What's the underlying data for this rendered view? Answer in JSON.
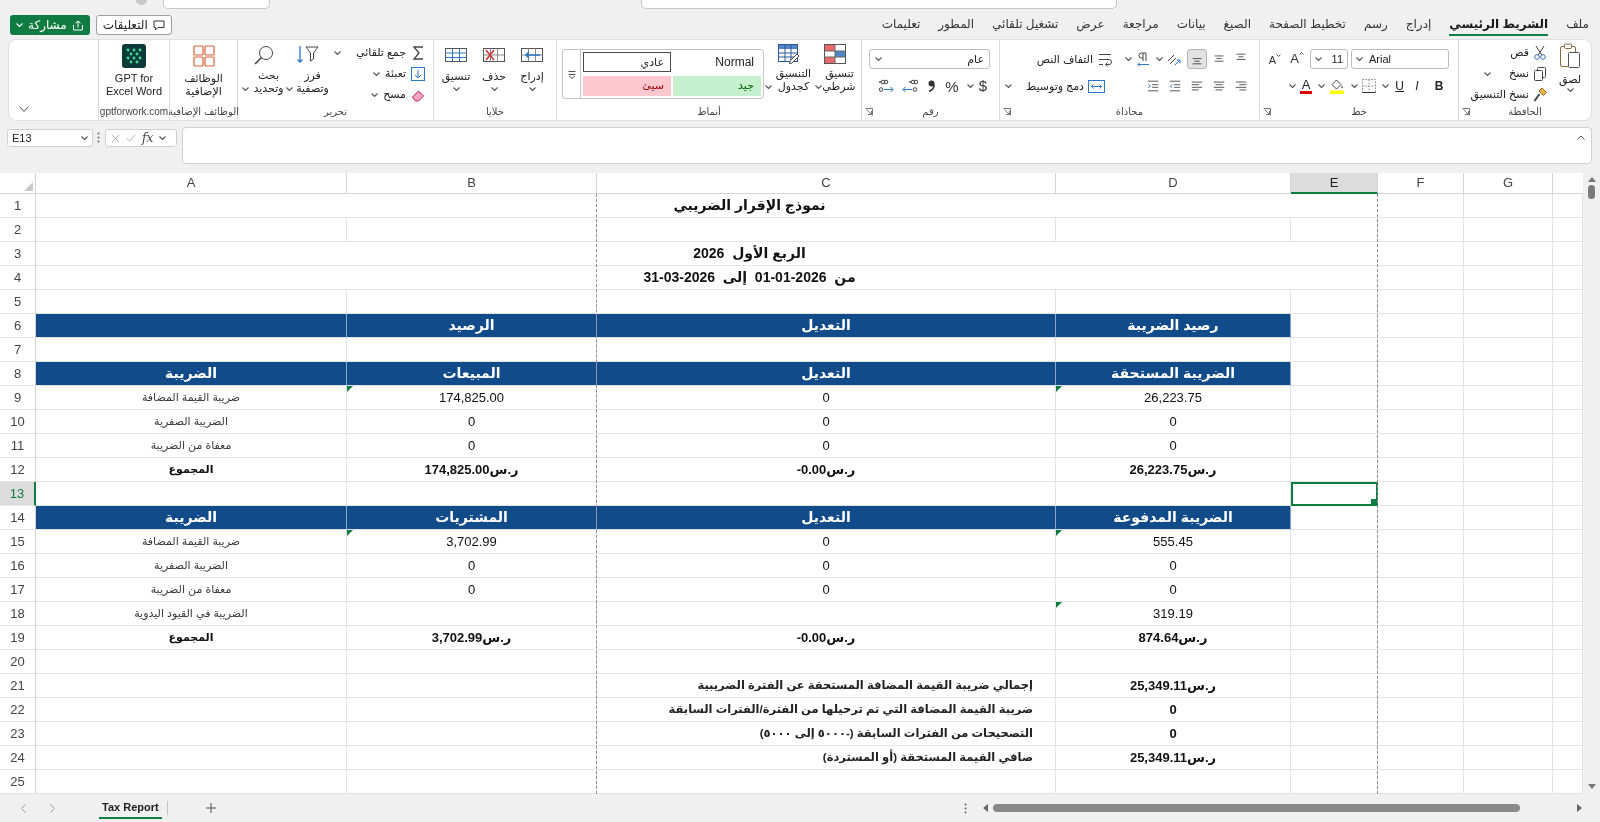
{
  "header_buttons": [
    {
      "kind": "comments",
      "label": "التعليقات"
    },
    {
      "kind": "share",
      "label": "مشاركة"
    }
  ],
  "ribbon_tabs": [
    {
      "label": "ملف",
      "selected": false
    },
    {
      "label": "الشريط الرئيسي",
      "selected": true
    },
    {
      "label": "إدراج",
      "selected": false
    },
    {
      "label": "رسم",
      "selected": false
    },
    {
      "label": "تخطيط الصفحة",
      "selected": false
    },
    {
      "label": "الصيغ",
      "selected": false
    },
    {
      "label": "بيانات",
      "selected": false
    },
    {
      "label": "مراجعة",
      "selected": false
    },
    {
      "label": "عرض",
      "selected": false
    },
    {
      "label": "تشغيل تلقائي",
      "selected": false
    },
    {
      "label": "المطور",
      "selected": false
    },
    {
      "label": "تعليمات",
      "selected": false
    }
  ],
  "ribbon_groups": [
    {
      "kind": "clipboard",
      "label": "الحافظة",
      "paste": "لصق",
      "cut": "قص",
      "copy": "نسخ",
      "format_painter": "نسخ التنسيق"
    },
    {
      "kind": "font",
      "label": "خط",
      "font_name": "Arial",
      "font_size": "11",
      "grow": "A",
      "shrink": "A",
      "bold": "B",
      "italic": "I",
      "underline": "U",
      "font_color": "A"
    },
    {
      "kind": "alignment",
      "label": "محاذاة",
      "vertical": [
        {
          "kind": "top",
          "selected": false
        },
        {
          "kind": "middle",
          "selected": false
        },
        {
          "kind": "bottom",
          "selected": true
        }
      ],
      "wrap_text": "التفاف النص",
      "merge": "دمج وتوسيط"
    },
    {
      "kind": "number",
      "label": "رقم",
      "format": "عام",
      "currency": "$",
      "percent": "%"
    },
    {
      "kind": "styles",
      "label": "أنماط",
      "conditional": "تنسيق شرطي",
      "as_table": "التنسيق كجدول",
      "gallery": [
        {
          "kind": "normal",
          "label": "Normal",
          "selected": false
        },
        {
          "kind": "plain",
          "label": "عادي",
          "selected": true
        },
        {
          "kind": "good",
          "label": "جيد",
          "selected": false
        },
        {
          "kind": "bad",
          "label": "سيئ",
          "selected": false
        }
      ]
    },
    {
      "kind": "cells",
      "label": "خلايا",
      "buttons": [
        {
          "kind": "insert",
          "label": "إدراج"
        },
        {
          "kind": "delete",
          "label": "حذف"
        },
        {
          "kind": "format",
          "label": "تنسيق"
        }
      ]
    },
    {
      "kind": "editing",
      "label": "تحرير",
      "autosum": "جمع تلقائي",
      "fill": "تعبئة",
      "clear": "مسح",
      "sort": "فرز وتصفية",
      "find": "بحث وتحديد"
    },
    {
      "kind": "addins",
      "label": "الوظائف الإضافية",
      "button": "الوظائف الإضافية"
    },
    {
      "kind": "gpt",
      "label": "gptforwork.com",
      "button": "GPT for Excel Word"
    }
  ],
  "formula_bar": {
    "name_box": "E13",
    "function_label": "fx"
  },
  "sheet": {
    "columns": [
      {
        "label": "G",
        "selected": false
      },
      {
        "label": "F",
        "selected": false
      },
      {
        "label": "E",
        "selected": true
      },
      {
        "label": "D",
        "selected": false
      },
      {
        "label": "C",
        "selected": false
      },
      {
        "label": "B",
        "selected": false
      },
      {
        "label": "A",
        "selected": false
      }
    ],
    "rows": [
      {
        "number": "1",
        "selected": false,
        "kind": "title",
        "text": "نموذج الإقرار الضريبي"
      },
      {
        "number": "2",
        "selected": false,
        "kind": "blank"
      },
      {
        "number": "3",
        "selected": false,
        "kind": "title",
        "text": "الربع الأول  2026"
      },
      {
        "number": "4",
        "selected": false,
        "kind": "title",
        "text": "من  2026-01-01  إلى  2026-03-31"
      },
      {
        "number": "5",
        "selected": false,
        "kind": "blank"
      },
      {
        "number": "6",
        "selected": false,
        "kind": "header",
        "b": "الرصيد",
        "c": "التعديل",
        "d": "رصيد الضريبة"
      },
      {
        "number": "7",
        "selected": false,
        "kind": "blank"
      },
      {
        "number": "8",
        "selected": false,
        "kind": "header",
        "a": "الضريبة",
        "b": "المبيعات",
        "c": "التعديل",
        "d": "الضريبة المستحقة"
      },
      {
        "number": "9",
        "selected": false,
        "kind": "data",
        "a": "ضريبة القيمة المضافة",
        "b": "174,825.00",
        "c": "0",
        "d": "26,223.75",
        "flag_b": true,
        "flag_d": true
      },
      {
        "number": "10",
        "selected": false,
        "kind": "data",
        "a": "الضريبة الصفرية",
        "b": "0",
        "c": "0",
        "d": "0",
        "flag_b": false,
        "flag_d": false
      },
      {
        "number": "11",
        "selected": false,
        "kind": "data",
        "a": "معفاة من الضريبة",
        "b": "0",
        "c": "0",
        "d": "0",
        "flag_b": false,
        "flag_d": false
      },
      {
        "number": "12",
        "selected": false,
        "kind": "total",
        "a": "المجموع",
        "b": "174,825.00ر.س",
        "c": "-0.00ر.س",
        "d": "26,223.75ر.س"
      },
      {
        "number": "13",
        "selected": true,
        "kind": "blank"
      },
      {
        "number": "14",
        "selected": false,
        "kind": "header",
        "a": "الضريبة",
        "b": "المشتريات",
        "c": "التعديل",
        "d": "الضريبة المدفوعة"
      },
      {
        "number": "15",
        "selected": false,
        "kind": "data",
        "a": "ضريبة القيمة المضافة",
        "b": "3,702.99",
        "c": "0",
        "d": "555.45",
        "flag_b": true,
        "flag_d": true
      },
      {
        "number": "16",
        "selected": false,
        "kind": "data",
        "a": "الضريبة الصفرية",
        "b": "0",
        "c": "0",
        "d": "0",
        "flag_b": false,
        "flag_d": false
      },
      {
        "number": "17",
        "selected": false,
        "kind": "data",
        "a": "معفاة من الضريبة",
        "b": "0",
        "c": "0",
        "d": "0",
        "flag_b": false,
        "flag_d": false
      },
      {
        "number": "18",
        "selected": false,
        "kind": "data",
        "a": "الضريبة في القيود اليدوية",
        "d": "319.19",
        "flag_b": false,
        "flag_d": true
      },
      {
        "number": "19",
        "selected": false,
        "kind": "total",
        "a": "المجموع",
        "b": "3,702.99ر.س",
        "c": "-0.00ر.س",
        "d": "874.64ر.س"
      },
      {
        "number": "20",
        "selected": false,
        "kind": "blank"
      },
      {
        "number": "21",
        "selected": false,
        "kind": "summary",
        "c": "إجمالي ضريبة القيمة المضافة المستحقة عن الفترة الضريبية",
        "d": "25,349.11ر.س"
      },
      {
        "number": "22",
        "selected": false,
        "kind": "summary",
        "c": "ضريبة القيمة المضافة التي تم ترحيلها من الفترة/الفترات السابقة",
        "d": "0"
      },
      {
        "number": "23",
        "selected": false,
        "kind": "summary",
        "c": "التصحيحات من الفترات السابقة (-٥٠٠٠ إلى ٥٠٠٠)",
        "d": "0"
      },
      {
        "number": "24",
        "selected": false,
        "kind": "summary",
        "c": "صافي القيمة المستحقة (أو المستردة)",
        "d": "25,349.11ر.س"
      },
      {
        "number": "25",
        "selected": false,
        "kind": "blank"
      }
    ]
  },
  "sheet_tabs": [
    {
      "label": "Tax Report",
      "selected": true
    }
  ]
}
